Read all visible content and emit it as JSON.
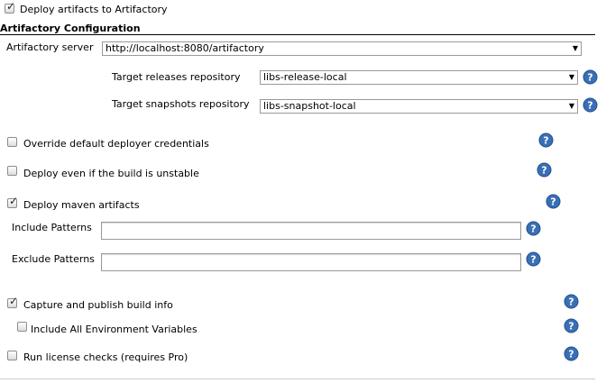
{
  "deploy_artifacts": {
    "label": "Deploy artifacts to Artifactory",
    "checked": true
  },
  "section": {
    "title": "Artifactory Configuration"
  },
  "server": {
    "label": "Artifactory server",
    "value": "http://localhost:8080/artifactory"
  },
  "releases_repo": {
    "label": "Target releases repository",
    "value": "libs-release-local"
  },
  "snapshots_repo": {
    "label": "Target snapshots repository",
    "value": "libs-snapshot-local"
  },
  "options": {
    "override_credentials": {
      "label": "Override default deployer credentials",
      "checked": false
    },
    "deploy_unstable": {
      "label": "Deploy even if the build is unstable",
      "checked": false
    },
    "deploy_maven": {
      "label": "Deploy maven artifacts",
      "checked": true
    },
    "capture_build_info": {
      "label": "Capture and publish build info",
      "checked": true
    },
    "include_env_vars": {
      "label": "Include All Environment Variables",
      "checked": false
    },
    "license_checks": {
      "label": "Run license checks (requires Pro)",
      "checked": false
    }
  },
  "patterns": {
    "include_label": "Include Patterns",
    "include_value": "",
    "exclude_label": "Exclude Patterns",
    "exclude_value": ""
  },
  "icons": {
    "help": "help-icon",
    "check": "checkmark-icon",
    "dropdown": "dropdown-arrow-icon"
  },
  "colors": {
    "help_blue": "#3a6fb5",
    "border": "#9a9a9a"
  }
}
